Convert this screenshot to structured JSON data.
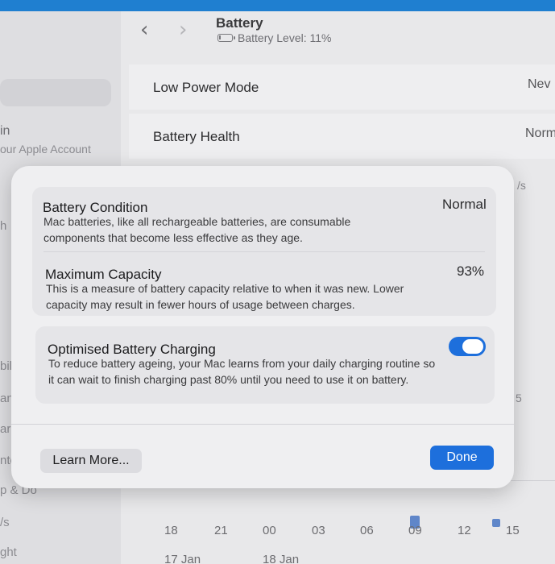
{
  "colors": {
    "accent": "#1d6fdc",
    "chart_bar": "#5f86c9"
  },
  "header": {
    "back_icon": "chevron-left-icon",
    "forward_icon": "chevron-right-icon",
    "title": "Battery",
    "battery_icon": "battery-low-icon",
    "battery_level": "Battery Level: 11%"
  },
  "sidebar": {
    "fragments": [
      "in",
      "our Apple Account",
      "h",
      "bil",
      "and",
      "ar",
      "nte",
      "p & Do",
      "/s",
      "ght"
    ]
  },
  "settings": {
    "rows": [
      {
        "label": "Low Power Mode",
        "value": "Nev"
      },
      {
        "label": "Battery Health",
        "value": "Norm"
      }
    ],
    "right_fragments": [
      "/s",
      "5"
    ]
  },
  "chart": {
    "ticks": [
      "18",
      "21",
      "00",
      "03",
      "06",
      "09",
      "12",
      "15"
    ],
    "dates": [
      "17 Jan",
      "18 Jan"
    ]
  },
  "dialog": {
    "condition": {
      "title": "Battery Condition",
      "value": "Normal",
      "description": "Mac batteries, like all rechargeable batteries, are consumable components that become less effective as they age."
    },
    "capacity": {
      "title": "Maximum Capacity",
      "value": "93%",
      "description": "This is a measure of battery capacity relative to when it was new. Lower capacity may result in fewer hours of usage between charges."
    },
    "optimised": {
      "title": "Optimised Battery Charging",
      "enabled": true,
      "description": "To reduce battery ageing, your Mac learns from your daily charging routine so it can wait to finish charging past 80% until you need to use it on battery."
    },
    "learn_more_label": "Learn More...",
    "done_label": "Done"
  }
}
